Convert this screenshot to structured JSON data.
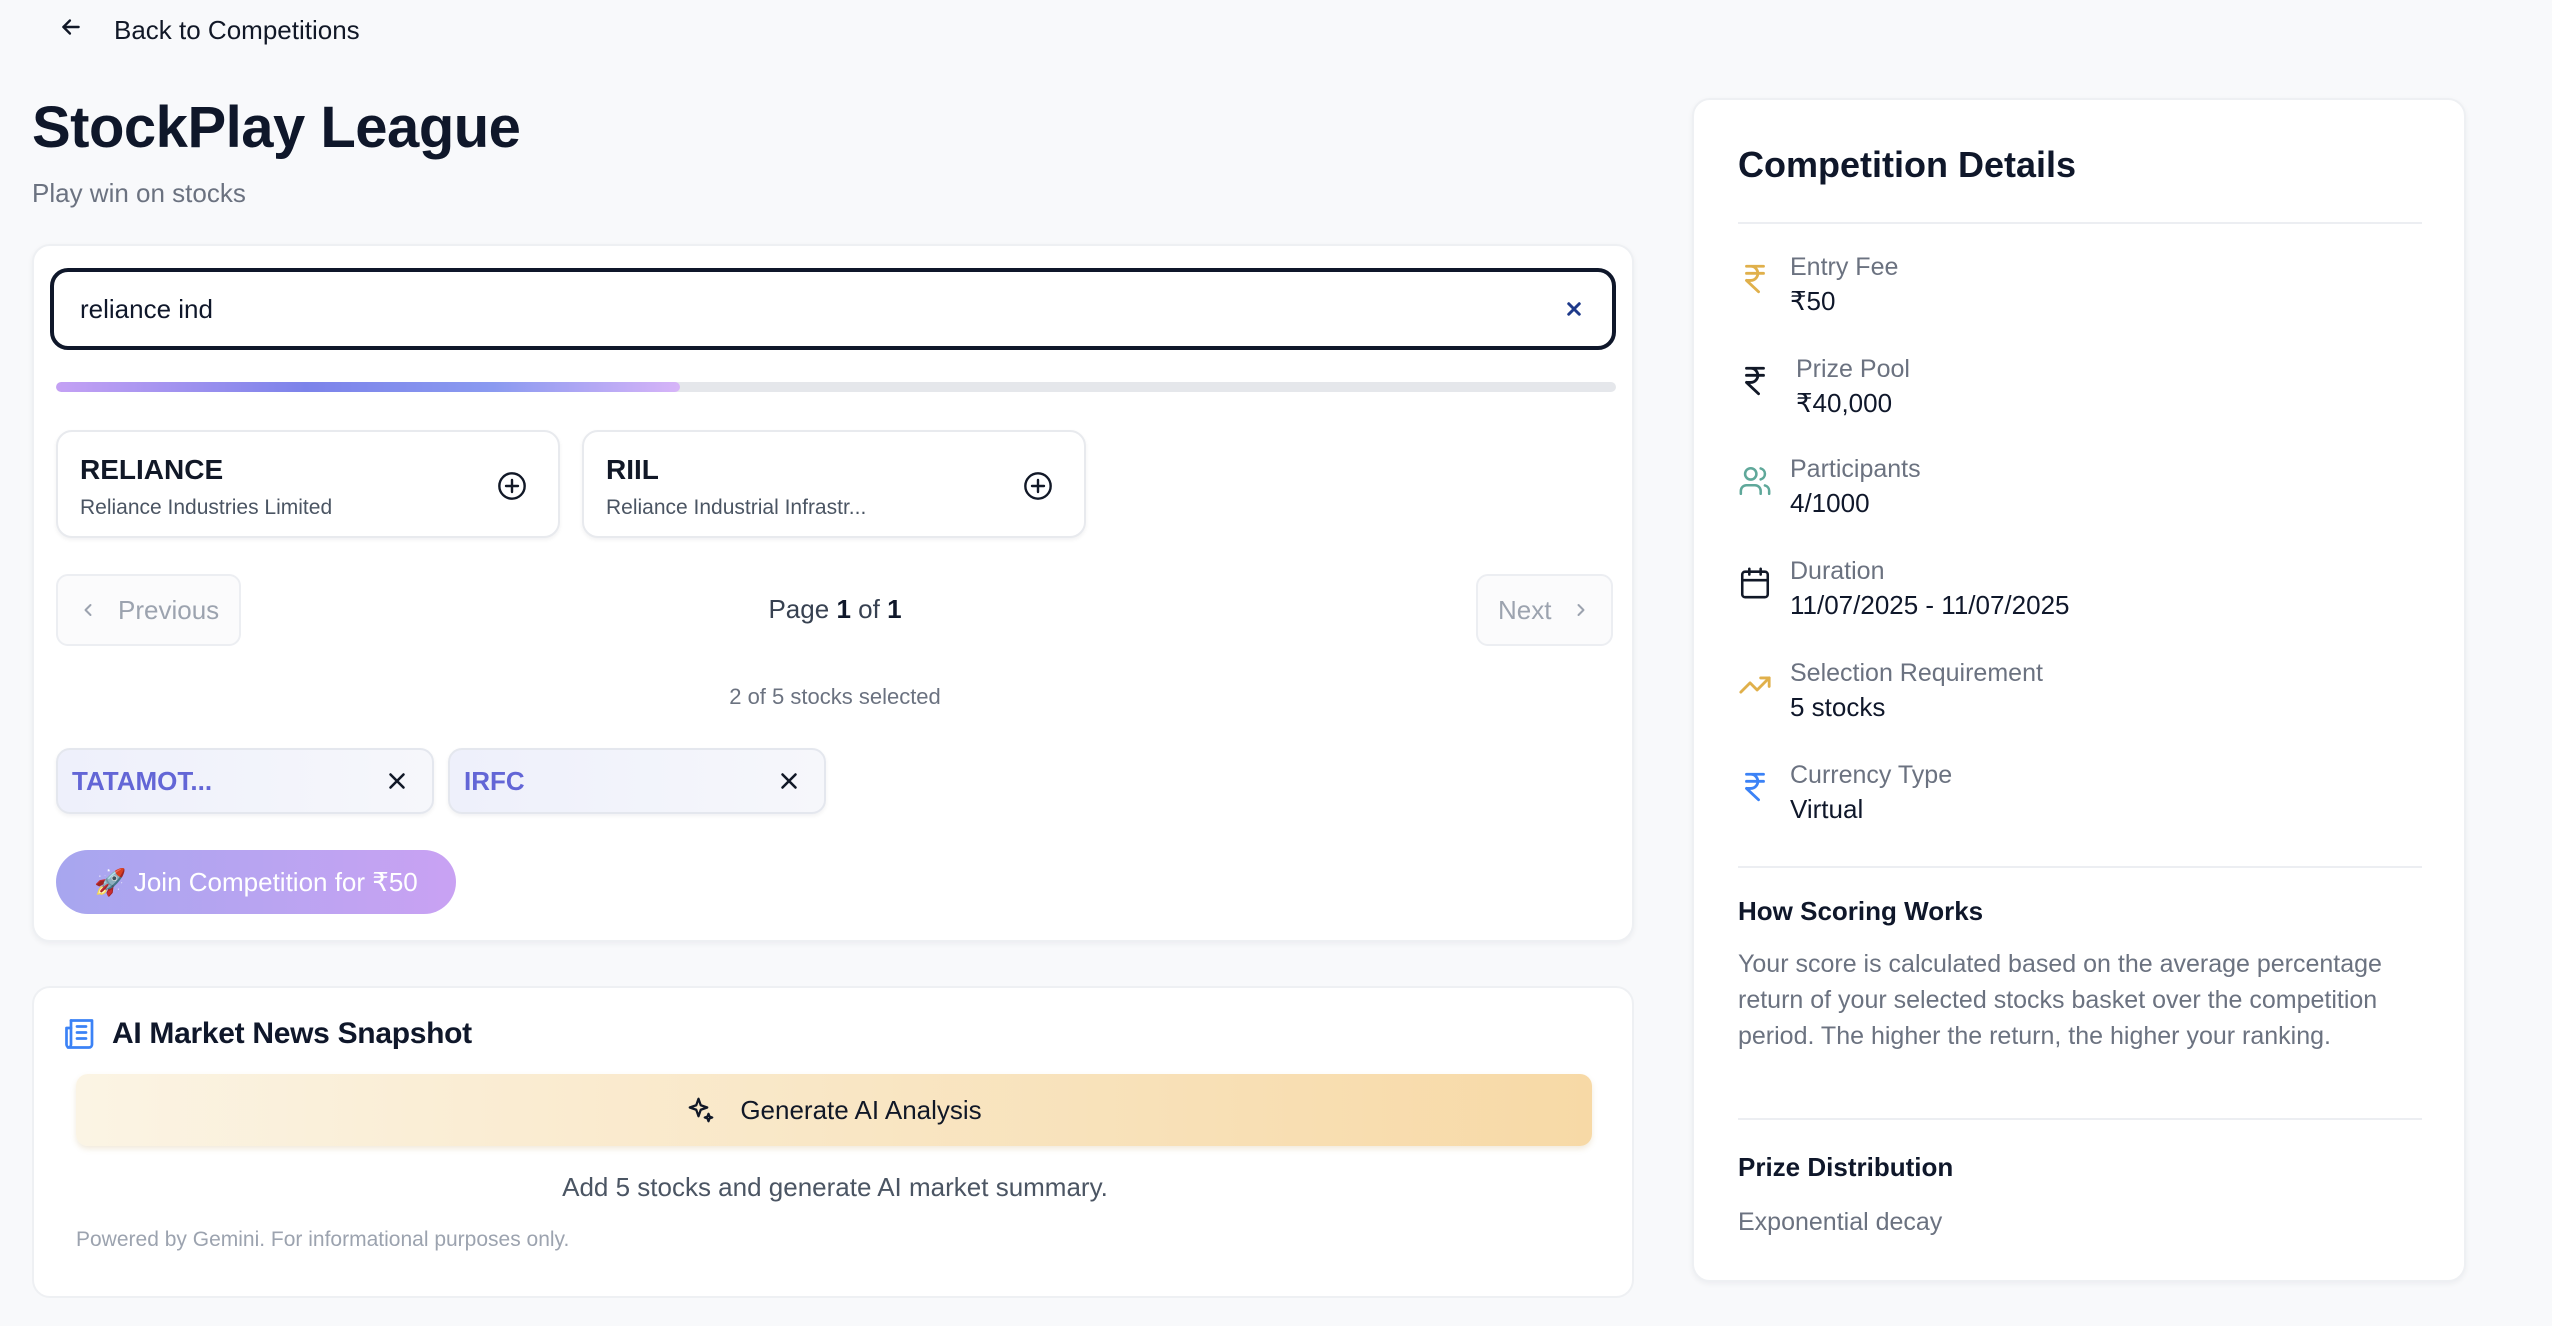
{
  "nav": {
    "back_label": "Back to Competitions"
  },
  "header": {
    "title": "StockPlay League",
    "subtitle": "Play win on stocks"
  },
  "search": {
    "value": "reliance ind",
    "placeholder": ""
  },
  "progress": {
    "percent": 40
  },
  "results": [
    {
      "symbol": "RELIANCE",
      "name": "Reliance Industries Limited"
    },
    {
      "symbol": "RIIL",
      "name": "Reliance Industrial Infrastr..."
    }
  ],
  "pagination": {
    "previous_label": "Previous",
    "next_label": "Next",
    "page_word": "Page",
    "of_word": "of",
    "current": "1",
    "total": "1"
  },
  "selection": {
    "count_text": "2 of 5 stocks selected",
    "chips": [
      {
        "label": "TATAMOT..."
      },
      {
        "label": "IRFC"
      }
    ]
  },
  "join": {
    "label": "🚀 Join Competition for ₹50"
  },
  "ai": {
    "title": "AI Market News Snapshot",
    "button_label": "Generate AI Analysis",
    "hint": "Add 5 stocks and generate AI market summary.",
    "footer": "Powered by Gemini. For informational purposes only."
  },
  "details": {
    "title": "Competition Details",
    "rows": [
      {
        "label": "Entry Fee",
        "value": "₹50",
        "icon": "rupee-icon",
        "color": "#e0b04b"
      },
      {
        "label": "Prize Pool",
        "value": "₹40,000",
        "icon": "rupee-icon",
        "color": "#111827"
      },
      {
        "label": "Participants",
        "value": "4/1000",
        "icon": "users-icon",
        "color": "#5fa89a"
      },
      {
        "label": "Duration",
        "value": "11/07/2025 - 11/07/2025",
        "icon": "calendar-icon",
        "color": "#111827"
      },
      {
        "label": "Selection Requirement",
        "value": "5 stocks",
        "icon": "trending-up-icon",
        "color": "#e0b04b"
      },
      {
        "label": "Currency Type",
        "value": "Virtual",
        "icon": "rupee-icon",
        "color": "#3b82f6"
      }
    ],
    "scoring_title": "How Scoring Works",
    "scoring_text": "Your score is calculated based on the average percentage return of your selected stocks basket over the competition period. The higher the return, the higher your ranking.",
    "prize_title": "Prize Distribution",
    "prize_text": "Exponential decay"
  }
}
